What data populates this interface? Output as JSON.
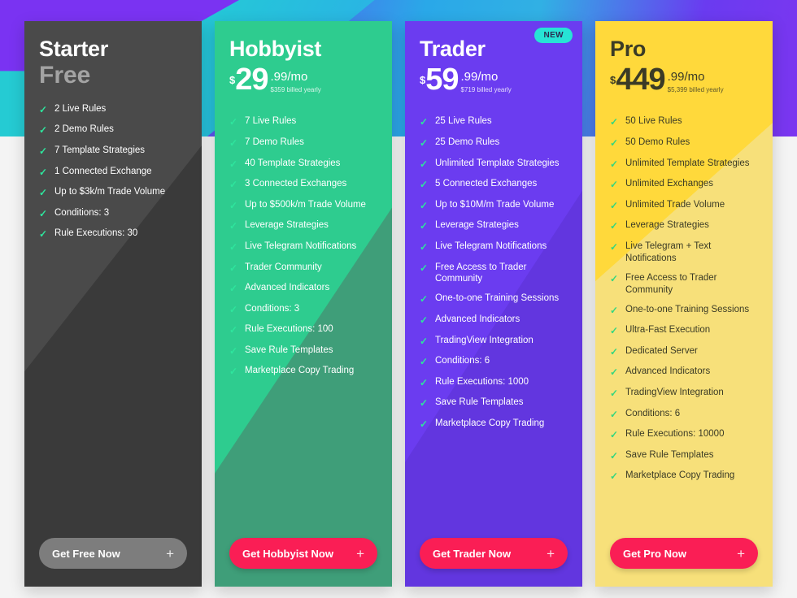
{
  "theme": {
    "accent_cta": "#fa1e55",
    "badge_color": "#27e3d5",
    "check_color": "#2ee59d"
  },
  "plans": [
    {
      "id": "starter",
      "name": "Starter",
      "free_label": "Free",
      "currency": "",
      "amount": "",
      "cents": "",
      "billed_yearly": "",
      "badge": "",
      "cta_label": "Get Free Now",
      "cta_plus": "+",
      "features": [
        "2 Live Rules",
        "2 Demo Rules",
        "7 Template Strategies",
        "1 Connected Exchange",
        "Up to $3k/m Trade Volume",
        "Conditions: 3",
        "Rule Executions: 30"
      ]
    },
    {
      "id": "hobbyist",
      "name": "Hobbyist",
      "free_label": "",
      "currency": "$",
      "amount": "29",
      "cents": ".99/mo",
      "billed_yearly": "$359 billed yearly",
      "badge": "",
      "cta_label": "Get Hobbyist Now",
      "cta_plus": "+",
      "features": [
        "7 Live Rules",
        "7 Demo Rules",
        "40 Template Strategies",
        "3 Connected Exchanges",
        "Up to $500k/m Trade Volume",
        "Leverage Strategies",
        "Live Telegram Notifications",
        "Trader Community",
        "Advanced Indicators",
        "Conditions: 3",
        "Rule Executions: 100",
        "Save Rule Templates",
        "Marketplace Copy Trading"
      ]
    },
    {
      "id": "trader",
      "name": "Trader",
      "free_label": "",
      "currency": "$",
      "amount": "59",
      "cents": ".99/mo",
      "billed_yearly": "$719 billed yearly",
      "badge": "NEW",
      "cta_label": "Get Trader Now",
      "cta_plus": "+",
      "features": [
        "25 Live Rules",
        "25 Demo Rules",
        "Unlimited Template Strategies",
        "5 Connected Exchanges",
        "Up to $10M/m Trade Volume",
        "Leverage Strategies",
        "Live Telegram Notifications",
        "Free Access to Trader Community",
        "One-to-one Training Sessions",
        "Advanced Indicators",
        "TradingView Integration",
        "Conditions: 6",
        "Rule Executions: 1000",
        "Save Rule Templates",
        "Marketplace Copy Trading"
      ]
    },
    {
      "id": "pro",
      "name": "Pro",
      "free_label": "",
      "currency": "$",
      "amount": "449",
      "cents": ".99/mo",
      "billed_yearly": "$5,399 billed yearly",
      "badge": "",
      "cta_label": "Get Pro Now",
      "cta_plus": "+",
      "features": [
        "50 Live Rules",
        "50 Demo Rules",
        "Unlimited Template Strategies",
        "Unlimited Exchanges",
        "Unlimited Trade Volume",
        "Leverage Strategies",
        "Live Telegram + Text Notifications",
        "Free Access to Trader Community",
        "One-to-one Training Sessions",
        "Ultra-Fast Execution",
        "Dedicated Server",
        "Advanced Indicators",
        "TradingView Integration",
        "Conditions: 6",
        "Rule Executions: 10000",
        "Save Rule Templates",
        "Marketplace Copy Trading"
      ]
    }
  ],
  "check_glyph": "✓"
}
